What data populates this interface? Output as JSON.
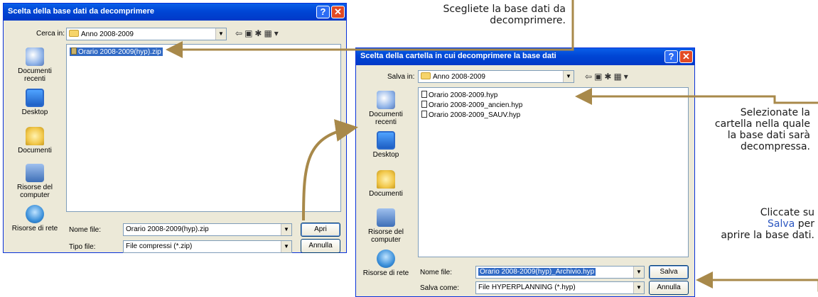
{
  "dialog1": {
    "title": "Scelta della base dati da decomprimere",
    "lookin_label": "Cerca in:",
    "lookin_value": "Anno 2008-2009",
    "places": [
      "Documenti recenti",
      "Desktop",
      "Documenti",
      "Risorse del computer",
      "Risorse di rete"
    ],
    "files": [
      "Orario 2008-2009(hyp).zip"
    ],
    "filename_label": "Nome file:",
    "filename_value": "Orario 2008-2009(hyp).zip",
    "filetype_label": "Tipo file:",
    "filetype_value": "File compressi (*.zip)",
    "open_button": "Apri",
    "cancel_button": "Annulla"
  },
  "dialog2": {
    "title": "Scelta della cartella in cui decomprimere la base dati",
    "savein_label": "Salva in:",
    "savein_value": "Anno 2008-2009",
    "places": [
      "Documenti recenti",
      "Desktop",
      "Documenti",
      "Risorse del computer",
      "Risorse di rete"
    ],
    "files": [
      "Orario 2008-2009.hyp",
      "Orario 2008-2009_ancien.hyp",
      "Orario 2008-2009_SAUV.hyp"
    ],
    "filename_label": "Nome file:",
    "filename_value": "Orario 2008-2009(hyp)_Archivio.hyp",
    "saveas_label": "Salva come:",
    "saveas_value": "File HYPERPLANNING (*.hyp)",
    "save_button": "Salva",
    "cancel_button": "Annulla"
  },
  "annotations": {
    "choose_db": "Scegliete la base dati da decomprimere.",
    "choose_folder": "Selezionate la cartella nella quale la base dati sarà decompressa.",
    "click_prefix": "Cliccate su",
    "click_link": "Salva",
    "click_mid": "per",
    "click_suffix": "aprire la base dati."
  },
  "colors": {
    "arrow": "#a8894a",
    "titlebar": "#0046d5",
    "link": "#2a55c0"
  }
}
